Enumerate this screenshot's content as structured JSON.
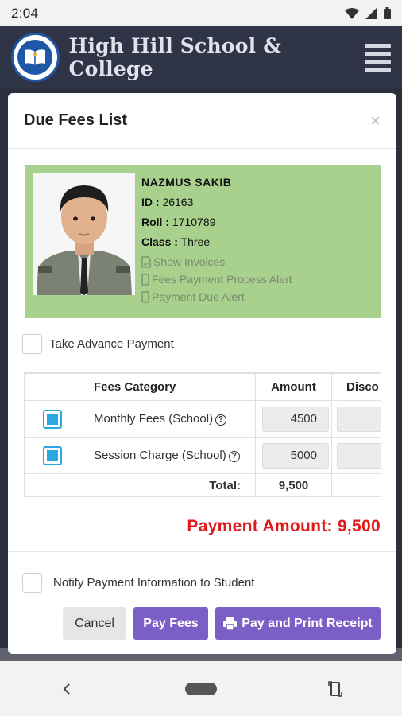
{
  "status_bar": {
    "time": "2:04"
  },
  "app": {
    "school_name": "High Hill School & College"
  },
  "modal": {
    "title": "Due Fees List",
    "close_label": "×",
    "student": {
      "name": "NAZMUS SAKIB",
      "id_label": "ID :",
      "id": "26163",
      "roll_label": "Roll :",
      "roll": "1710789",
      "class_label": "Class :",
      "class": "Three",
      "links": [
        "Show Invoices",
        "Fees Payment Process Alert",
        "Payment Due Alert"
      ]
    },
    "advance_payment_label": "Take Advance Payment",
    "table": {
      "headers": [
        "Fees Category",
        "Amount",
        "Disco"
      ],
      "rows": [
        {
          "category": "Monthly Fees (School)",
          "amount": "4500",
          "selected": true
        },
        {
          "category": "Session Charge (School)",
          "amount": "5000",
          "selected": true
        }
      ],
      "total_label": "Total:",
      "total_value": "9,500"
    },
    "payment_amount": "Payment Amount: 9,500",
    "notify_label": "Notify Payment Information to Student",
    "buttons": {
      "cancel": "Cancel",
      "pay": "Pay Fees",
      "pay_print": "Pay and Print Receipt"
    }
  },
  "colors": {
    "accent": "#7b5fc6",
    "profile_bg": "#a9d18e",
    "payment_amount": "#e01a1a",
    "checkbox": "#29a9e0",
    "header_bg": "#2f3547"
  }
}
